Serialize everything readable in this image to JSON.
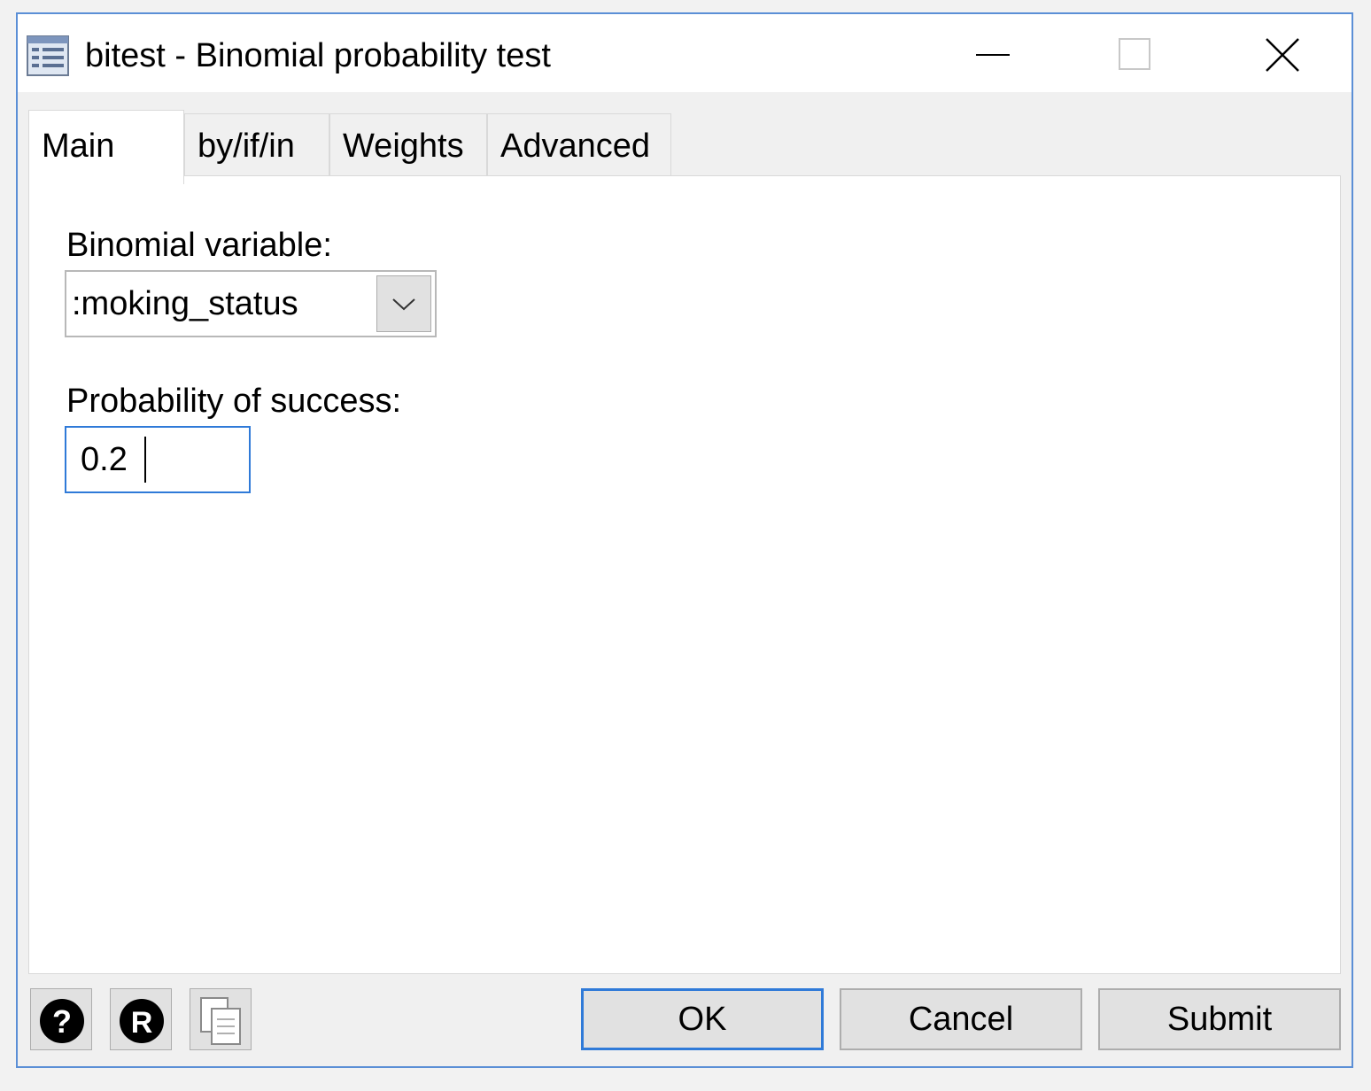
{
  "window": {
    "title": "bitest - Binomial probability test",
    "icons": {
      "app": "dialog-list-icon",
      "minimize": "minimize-icon",
      "maximize": "maximize-icon",
      "close": "close-icon"
    }
  },
  "tabs": [
    {
      "label": "Main",
      "active": true
    },
    {
      "label": "by/if/in",
      "active": false
    },
    {
      "label": "Weights",
      "active": false
    },
    {
      "label": "Advanced",
      "active": false
    }
  ],
  "main": {
    "binomial_variable": {
      "label": "Binomial variable:",
      "value": ":moking_status"
    },
    "probability": {
      "label": "Probability of success:",
      "value": "0.2"
    }
  },
  "footer": {
    "icons": {
      "help": "help-icon",
      "reset": "reset-icon",
      "copy": "copy-command-icon"
    },
    "ok_label": "OK",
    "cancel_label": "Cancel",
    "submit_label": "Submit"
  },
  "colors": {
    "accent": "#2f7ad8",
    "window_border": "#5b8fd6",
    "button_face": "#e1e1e1"
  }
}
